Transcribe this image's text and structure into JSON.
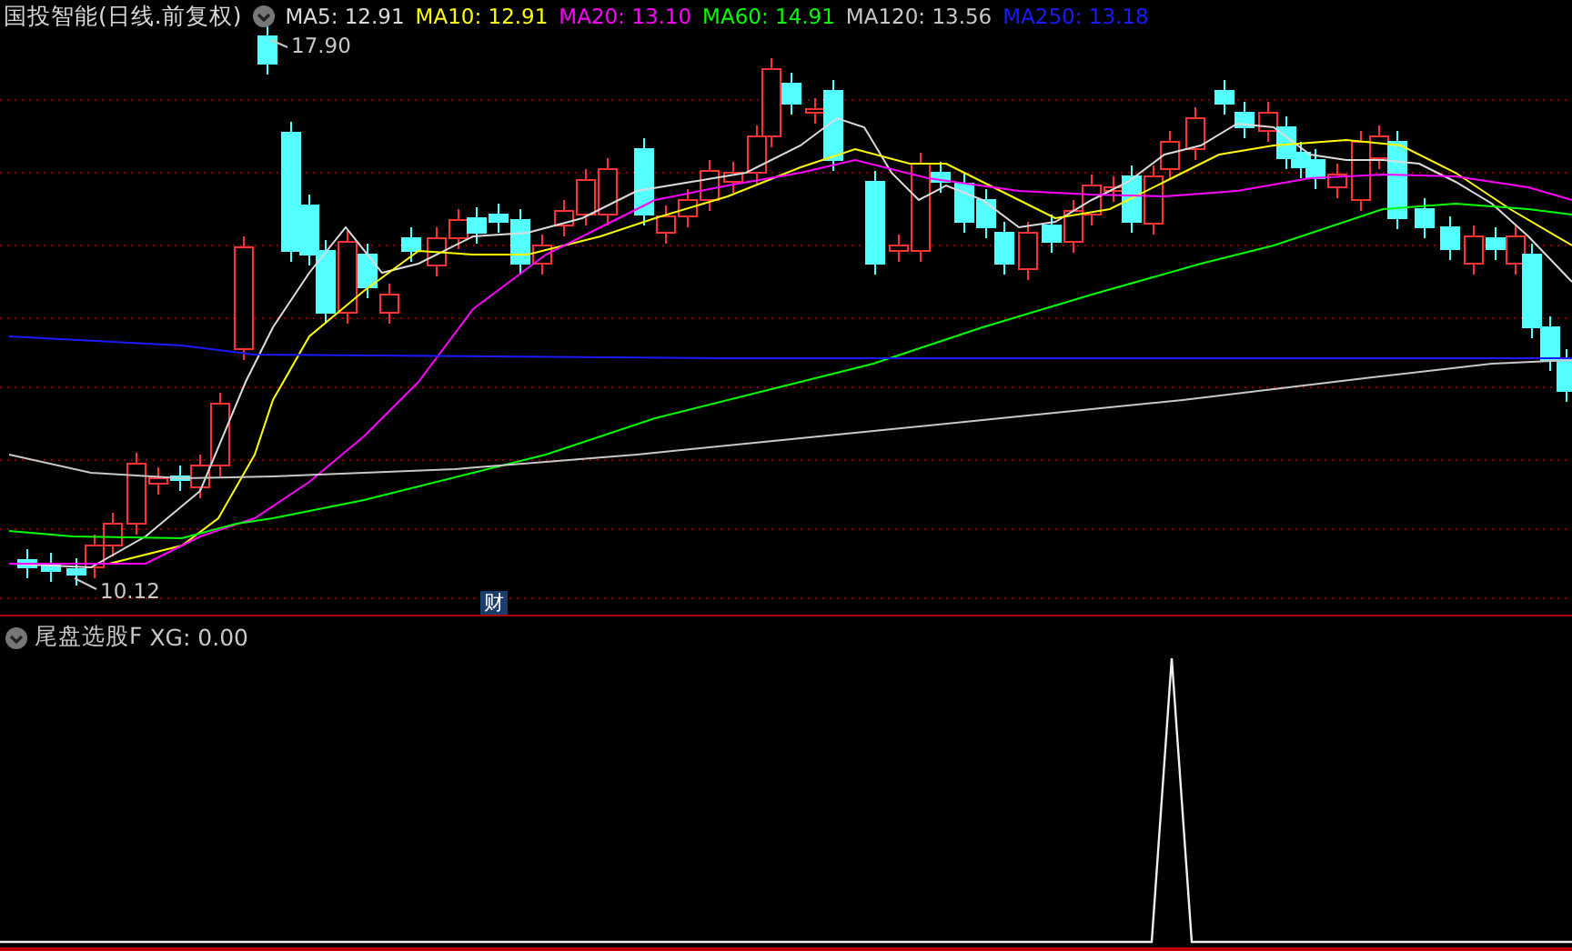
{
  "title": "国投智能(日线.前复权)",
  "indicators": [
    {
      "label": "MA5: 12.91",
      "color": "#dcdcdc"
    },
    {
      "label": "MA10: 12.91",
      "color": "#ffff00"
    },
    {
      "label": "MA20: 13.10",
      "color": "#ff00ff"
    },
    {
      "label": "MA60: 14.91",
      "color": "#00ff00"
    },
    {
      "label": "MA120: 13.56",
      "color": "#c8c8c8"
    },
    {
      "label": "MA250: 13.18",
      "color": "#1a1aff"
    }
  ],
  "price_marks": {
    "high": "17.90",
    "low": "10.12"
  },
  "badge": "财",
  "sub_panel": {
    "title": "尾盘选股F",
    "reading": "XG: 0.00"
  }
}
